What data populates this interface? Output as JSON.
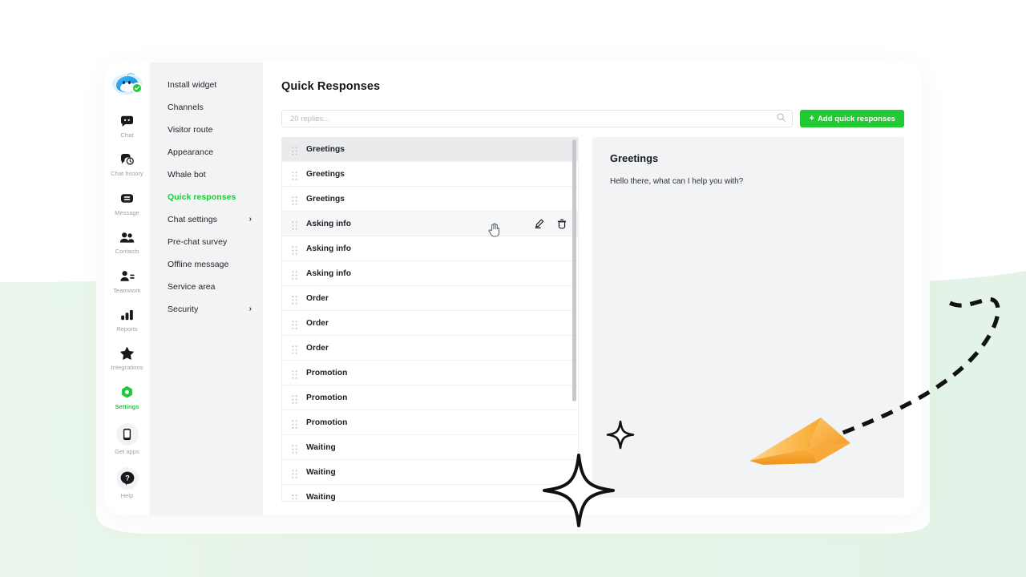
{
  "app": {
    "logo_icon": "whale-mascot-avatar",
    "online_badge_icon": "check-circle-icon"
  },
  "rail": {
    "items": [
      {
        "label": "Chat",
        "icon": "chat-bubble-icon",
        "active": false
      },
      {
        "label": "Chat history",
        "icon": "chat-history-icon",
        "active": false
      },
      {
        "label": "Message",
        "icon": "message-envelope-icon",
        "active": false
      },
      {
        "label": "Contacts",
        "icon": "contacts-people-icon",
        "active": false
      },
      {
        "label": "Teamwork",
        "icon": "teamwork-person-icon",
        "active": false
      },
      {
        "label": "Reports",
        "icon": "bar-chart-icon",
        "active": false
      },
      {
        "label": "Integrations",
        "icon": "star-icon",
        "active": false
      },
      {
        "label": "Settings",
        "icon": "gear-hex-icon",
        "active": true
      }
    ],
    "bottom_items": [
      {
        "label": "Get apps",
        "icon": "mobile-phone-icon"
      },
      {
        "label": "Help",
        "icon": "question-mark-icon"
      }
    ]
  },
  "settings_nav": {
    "items": [
      {
        "label": "Install widget",
        "active": false,
        "chevron": false
      },
      {
        "label": "Channels",
        "active": false,
        "chevron": false
      },
      {
        "label": "Visitor route",
        "active": false,
        "chevron": false
      },
      {
        "label": "Appearance",
        "active": false,
        "chevron": false
      },
      {
        "label": "Whale bot",
        "active": false,
        "chevron": false
      },
      {
        "label": "Quick responses",
        "active": true,
        "chevron": false
      },
      {
        "label": "Chat settings",
        "active": false,
        "chevron": true
      },
      {
        "label": "Pre-chat survey",
        "active": false,
        "chevron": false
      },
      {
        "label": "Offline message",
        "active": false,
        "chevron": false
      },
      {
        "label": "Service area",
        "active": false,
        "chevron": false
      },
      {
        "label": "Security",
        "active": false,
        "chevron": true
      }
    ],
    "chevron_glyph": "›"
  },
  "main": {
    "title": "Quick Responses",
    "search": {
      "value": "",
      "placeholder": "20 replies...",
      "icon": "search-icon"
    },
    "add_button": {
      "label": "Add quick responses",
      "plus_glyph": "+",
      "color": "#22c933"
    },
    "list": {
      "row_icons": {
        "drag": "drag-handle-icon",
        "edit": "pencil-edit-icon",
        "delete": "trash-delete-icon"
      },
      "rows": [
        {
          "label": "Greetings",
          "selected": true,
          "hovered": false
        },
        {
          "label": "Greetings",
          "selected": false,
          "hovered": false
        },
        {
          "label": "Greetings",
          "selected": false,
          "hovered": false
        },
        {
          "label": "Asking info",
          "selected": false,
          "hovered": true
        },
        {
          "label": "Asking info",
          "selected": false,
          "hovered": false
        },
        {
          "label": "Asking info",
          "selected": false,
          "hovered": false
        },
        {
          "label": "Order",
          "selected": false,
          "hovered": false
        },
        {
          "label": "Order",
          "selected": false,
          "hovered": false
        },
        {
          "label": "Order",
          "selected": false,
          "hovered": false
        },
        {
          "label": "Promotion",
          "selected": false,
          "hovered": false
        },
        {
          "label": "Promotion",
          "selected": false,
          "hovered": false
        },
        {
          "label": "Promotion",
          "selected": false,
          "hovered": false
        },
        {
          "label": "Waiting",
          "selected": false,
          "hovered": false
        },
        {
          "label": "Waiting",
          "selected": false,
          "hovered": false
        },
        {
          "label": "Waiting",
          "selected": false,
          "hovered": false
        }
      ]
    },
    "detail": {
      "title": "Greetings",
      "body": "Hello there, what can I help you with?"
    }
  },
  "decorations": {
    "paper_plane_icon": "paper-plane-icon",
    "dashed_trail_icon": "dashed-curve-trail",
    "sparkle_large_icon": "sparkle-star-icon",
    "sparkle_small_icon": "sparkle-star-icon",
    "cursor_icon": "pointer-hand-cursor",
    "background_color": "#e6f4e8",
    "plane_color": "#f9a83a"
  }
}
